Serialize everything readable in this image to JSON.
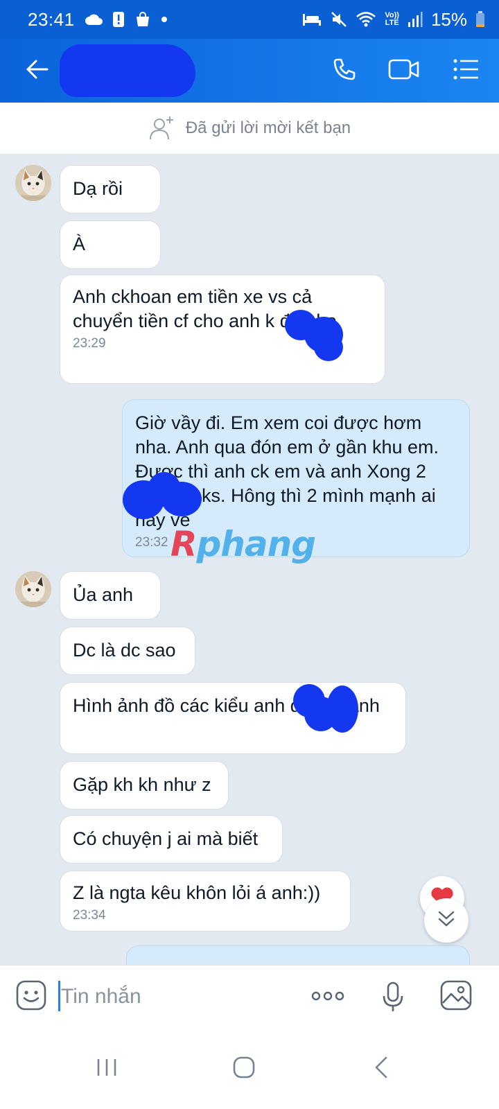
{
  "status_bar": {
    "time": "23:41",
    "battery": "15%",
    "left_icons": [
      "cloud-icon",
      "alert-icon",
      "shopping-bag-icon",
      "dot-icon"
    ],
    "right_icons": [
      "bed-icon",
      "mute-icon",
      "wifi-icon",
      "volte-icon",
      "signal-icon",
      "battery-icon"
    ],
    "volte_label_top": "Vo))",
    "volte_label_bottom": "LTE"
  },
  "header": {
    "contact_name": "",
    "icons": [
      "back-arrow-icon",
      "phone-icon",
      "video-icon",
      "menu-list-icon"
    ],
    "accent_color": "#0a63db"
  },
  "banner": {
    "text": "Đã gửi lời mời kết bạn"
  },
  "messages": [
    {
      "sender": "them",
      "text": "Dạ rồi"
    },
    {
      "sender": "them",
      "text": "À"
    },
    {
      "sender": "them",
      "text": "Anh ckhoan em tiền xe vs cả chuyển tiền cf cho anh k đã nha",
      "time": "23:29"
    },
    {
      "sender": "me",
      "text": "Giờ vầy đi. Em xem coi được hơm nha. Anh qua đón em ở gần khu em. Được thì anh ck em và anh Xong 2 mình đi ks. Hông thì 2 mình mạnh ai nấy về",
      "time": "23:32"
    },
    {
      "sender": "them",
      "text": "Ủa anh"
    },
    {
      "sender": "them",
      "text": "Dc là dc sao"
    },
    {
      "sender": "them",
      "text": "Hình ảnh đồ các kiểu anh đã gửi anh"
    },
    {
      "sender": "them",
      "text": "Gặp kh kh như z"
    },
    {
      "sender": "them",
      "text": "Có chuyện j ai mà biết"
    },
    {
      "sender": "them",
      "text": "Z là ngta kêu khôn lỏi á anh:))",
      "time": "23:34"
    }
  ],
  "watermark": {
    "text_r": "R",
    "text_rest": "phang"
  },
  "input": {
    "placeholder": "Tin nhắn",
    "icons": [
      "emoji-icon",
      "more-dots-icon",
      "microphone-icon",
      "image-icon"
    ]
  },
  "nav": {
    "icons": [
      "recent-apps-icon",
      "home-icon",
      "back-icon"
    ]
  },
  "colors": {
    "chat_background": "#e2e9f1",
    "my_bubble": "#d5ebfb",
    "their_bubble": "#ffffff",
    "header_blue": "#0a63db"
  }
}
